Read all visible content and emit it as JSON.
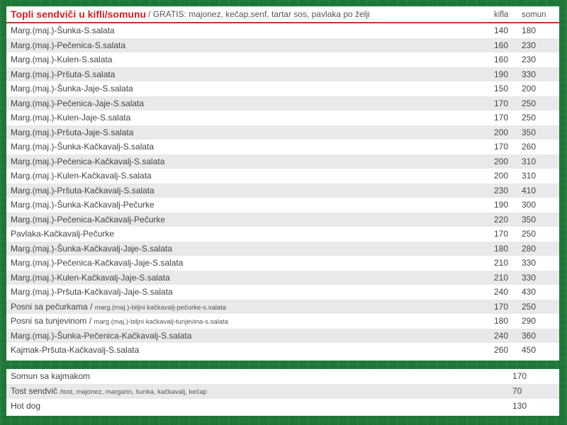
{
  "menu": {
    "title": "Topli sendviči u kifli/somunu",
    "subtitle": "/ GRATIS: majonez, kečap,senf, tartar sos, pavlaka po želji",
    "col_kifla": "kifla",
    "col_somun": "somun",
    "rows": [
      {
        "name": "Marg.(maj.)-Šunka-S.salata",
        "note": "",
        "kifla": "140",
        "somun": "180"
      },
      {
        "name": "Marg.(maj.)-Pečenica-S.salata",
        "note": "",
        "kifla": "160",
        "somun": "230"
      },
      {
        "name": "Marg.(maj.)-Kulen-S.salata",
        "note": "",
        "kifla": "160",
        "somun": "230"
      },
      {
        "name": "Marg.(maj.)-Pršuta-S.salata",
        "note": "",
        "kifla": "190",
        "somun": "330"
      },
      {
        "name": "Marg.(maj.)-Šunka-Jaje-S.salata",
        "note": "",
        "kifla": "150",
        "somun": "200"
      },
      {
        "name": "Marg.(maj.)-Pečenica-Jaje-S.salata",
        "note": "",
        "kifla": "170",
        "somun": "250"
      },
      {
        "name": "Marg.(maj.)-Kulen-Jaje-S.salata",
        "note": "",
        "kifla": "170",
        "somun": "250"
      },
      {
        "name": "Marg.(maj.)-Pršuta-Jaje-S.salata",
        "note": "",
        "kifla": "200",
        "somun": "350"
      },
      {
        "name": "Marg.(maj.)-Šunka-Kačkavalj-S.salata",
        "note": "",
        "kifla": "170",
        "somun": "260"
      },
      {
        "name": "Marg.(maj.)-Pečenica-Kačkavalj-S.salata",
        "note": "",
        "kifla": "200",
        "somun": "310"
      },
      {
        "name": "Marg.(maj.)-Kulen-Kačkavalj-S.salata",
        "note": "",
        "kifla": "200",
        "somun": "310"
      },
      {
        "name": "Marg.(maj.)-Pršuta-Kačkavalj-S.salata",
        "note": "",
        "kifla": "230",
        "somun": "410"
      },
      {
        "name": "Marg.(maj.)-Šunka-Kačkavalj-Pečurke",
        "note": "",
        "kifla": "190",
        "somun": "300"
      },
      {
        "name": "Marg.(maj.)-Pečenica-Kačkavalj-Pečurke",
        "note": "",
        "kifla": "220",
        "somun": "350"
      },
      {
        "name": "Pavlaka-Kačkavalj-Pečurke",
        "note": "",
        "kifla": "170",
        "somun": "250"
      },
      {
        "name": "Marg.(maj.)-Šunka-Kačkavalj-Jaje-S.salata",
        "note": "",
        "kifla": "180",
        "somun": "280"
      },
      {
        "name": "Marg.(maj.)-Pečenica-Kačkavalj-Jaje-S.salata",
        "note": "",
        "kifla": "210",
        "somun": "330"
      },
      {
        "name": "Marg.(maj.)-Kulen-Kačkavalj-Jaje-S.salata",
        "note": "",
        "kifla": "210",
        "somun": "330"
      },
      {
        "name": "Marg.(maj.)-Pršuta-Kačkavalj-Jaje-S.salata",
        "note": "",
        "kifla": "240",
        "somun": "430"
      },
      {
        "name": "Posni sa pečurkama /",
        "note": "marg.(maj.)-biljni kačkavalj-pečurke-s.salata",
        "kifla": "170",
        "somun": "250"
      },
      {
        "name": "Posni sa tunjevinom /",
        "note": "marg.(maj.)-biljni kačkavalj-tunjevina-s.salata",
        "kifla": "180",
        "somun": "290"
      },
      {
        "name": "Marg.(maj.)-Šunka-Pečenica-Kačkavalj-S.salata",
        "note": "",
        "kifla": "240",
        "somun": "360"
      },
      {
        "name": "Kajmak-Pršuta-Kačkavalj-S.salata",
        "note": "",
        "kifla": "260",
        "somun": "450"
      }
    ]
  },
  "extras": {
    "rows": [
      {
        "name": "Somun sa kajmakom",
        "note": "",
        "price": "170"
      },
      {
        "name": "Tost sendvič",
        "note": "/tost, majonez, margarin, šunka, kačkavalj, kečap",
        "price": "70"
      },
      {
        "name": "Hot dog",
        "note": "",
        "price": "130"
      }
    ]
  },
  "colors": {
    "background": "#1f7a3a",
    "title": "#d32020",
    "row_alt": "#e9e9e9"
  }
}
